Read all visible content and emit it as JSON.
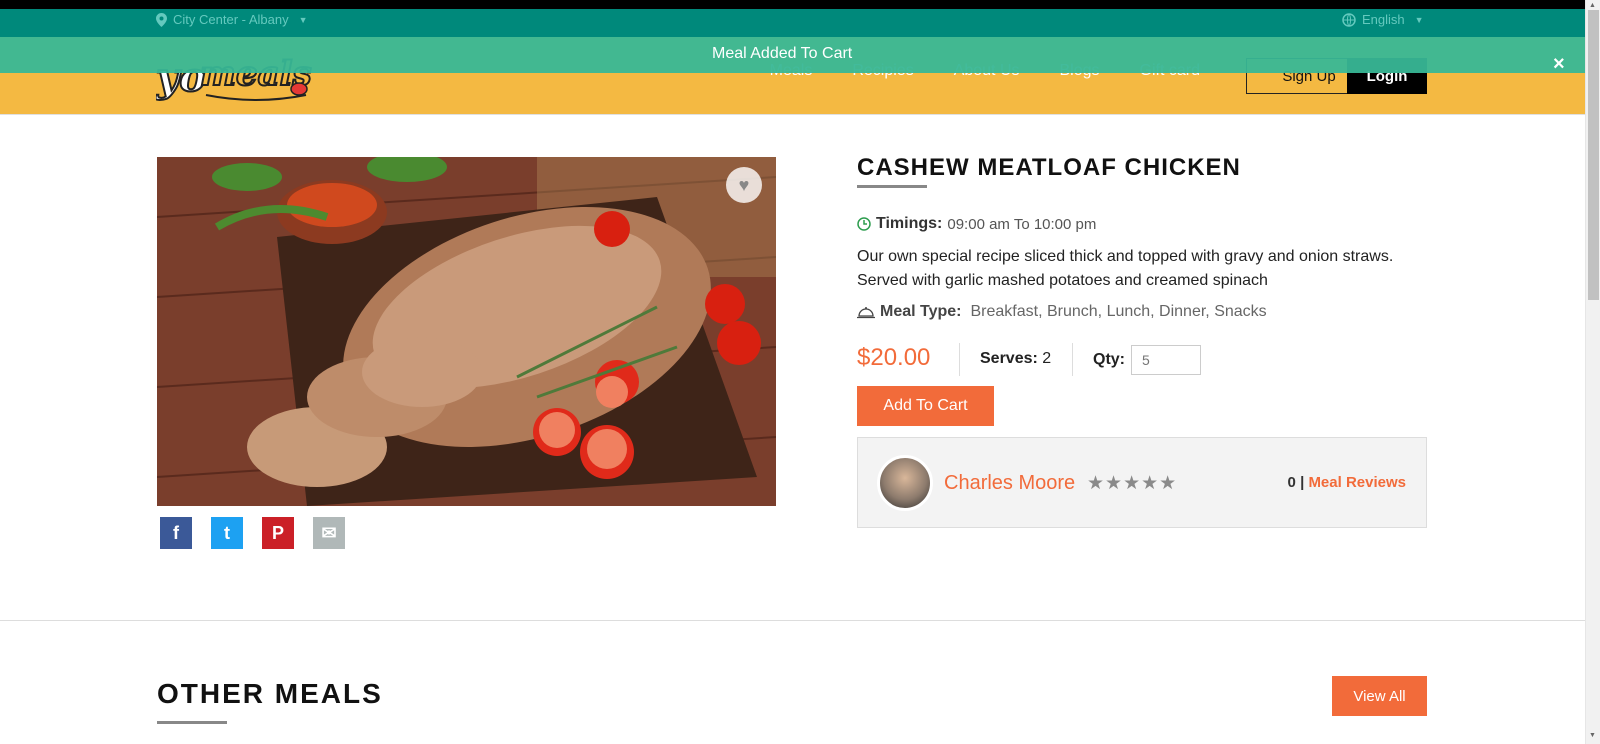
{
  "topbar": {
    "location": "City Center - Albany",
    "language": "English"
  },
  "toast": {
    "message": "Meal Added To Cart",
    "close": "×"
  },
  "nav": {
    "items": [
      "Meals",
      "Recipies",
      "About Us",
      "Blogs",
      "Gift card"
    ],
    "signup": "Sign Up",
    "login": "Login"
  },
  "meal": {
    "title": "CASHEW MEATLOAF CHICKEN",
    "timings_label": "Timings:",
    "timings_value": "09:00 am To 10:00 pm",
    "description": "Our own special recipe sliced thick and topped with gravy and onion straws. Served with garlic mashed potatoes and creamed spinach",
    "meal_type_label": "Meal Type:",
    "meal_type_value": "Breakfast, Brunch, Lunch, Dinner, Snacks",
    "price": "$20.00",
    "serves_label": "Serves:",
    "serves_value": "2",
    "qty_label": "Qty:",
    "qty_placeholder": "5",
    "add_to_cart": "Add To Cart"
  },
  "chef": {
    "name": "Charles Moore",
    "stars": "★★★★★",
    "review_count": "0",
    "separator": "|",
    "reviews_link": "Meal Reviews"
  },
  "social": {
    "facebook": "f",
    "twitter": "t",
    "pinterest": "P",
    "email": "✉"
  },
  "other_meals": {
    "heading": "OTHER MEALS",
    "view_all": "View All"
  },
  "colors": {
    "accent": "#f26b3a",
    "header_yellow": "#f4b942",
    "topbar_teal": "#00897b",
    "toast_green": "#38b796"
  }
}
